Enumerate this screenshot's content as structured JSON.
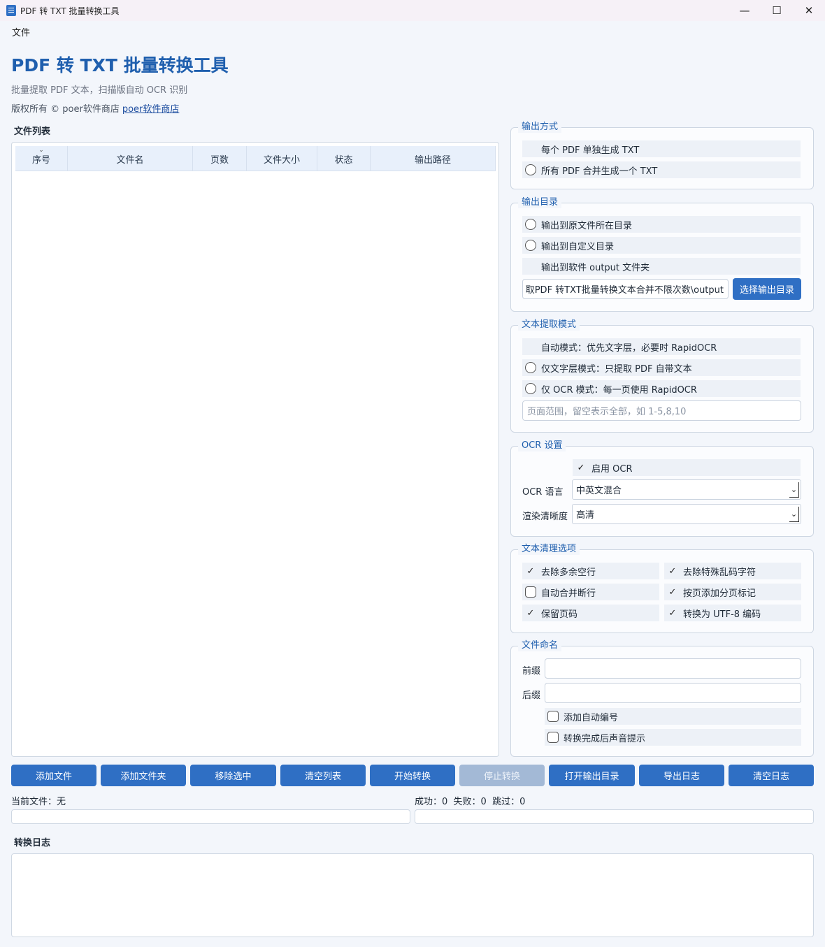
{
  "window": {
    "title": "PDF 转 TXT 批量转换工具",
    "minimize": "—",
    "maximize": "☐",
    "close": "✕"
  },
  "menu": {
    "file": "文件"
  },
  "header": {
    "title": "PDF 转 TXT 批量转换工具",
    "subtitle": "批量提取 PDF 文本，扫描版自动 OCR 识别",
    "copyright": "版权所有 © poer软件商店",
    "link": "poer软件商店"
  },
  "file_list": {
    "label": "文件列表",
    "columns": [
      "序号",
      "文件名",
      "页数",
      "文件大小",
      "状态",
      "输出路径"
    ],
    "rows": []
  },
  "output_mode": {
    "title": "输出方式",
    "options": [
      "每个 PDF 单独生成 TXT",
      "所有 PDF 合并生成一个 TXT"
    ],
    "selected": 0
  },
  "output_dir": {
    "title": "输出目录",
    "options": [
      "输出到原文件所在目录",
      "输出到自定义目录",
      "输出到软件 output 文件夹"
    ],
    "selected": 2,
    "path": "取PDF 转TXT批量转换文本合并不限次数\\output",
    "choose_button": "选择输出目录"
  },
  "extract_mode": {
    "title": "文本提取模式",
    "options": [
      "自动模式：优先文字层，必要时 RapidOCR",
      "仅文字层模式：只提取 PDF 自带文本",
      "仅 OCR 模式：每一页使用 RapidOCR"
    ],
    "selected": 0,
    "page_range_placeholder": "页面范围，留空表示全部，如 1-5,8,10"
  },
  "ocr": {
    "title": "OCR 设置",
    "enable_label": "启用 OCR",
    "enabled": true,
    "language_label": "OCR 语言",
    "language_value": "中英文混合",
    "clarity_label": "渲染清晰度",
    "clarity_value": "高清"
  },
  "cleanup": {
    "title": "文本清理选项",
    "options": [
      {
        "label": "去除多余空行",
        "checked": true
      },
      {
        "label": "去除特殊乱码字符",
        "checked": true
      },
      {
        "label": "自动合并断行",
        "checked": false
      },
      {
        "label": "按页添加分页标记",
        "checked": true
      },
      {
        "label": "保留页码",
        "checked": true
      },
      {
        "label": "转换为 UTF-8 编码",
        "checked": true
      }
    ]
  },
  "naming": {
    "title": "文件命名",
    "prefix_label": "前缀",
    "prefix_value": "",
    "suffix_label": "后缀",
    "suffix_value": "",
    "auto_number": {
      "label": "添加自动编号",
      "checked": false
    },
    "sound": {
      "label": "转换完成后声音提示",
      "checked": false
    }
  },
  "actions": {
    "add_file": "添加文件",
    "add_folder": "添加文件夹",
    "remove_selected": "移除选中",
    "clear_list": "清空列表",
    "start": "开始转换",
    "stop": "停止转换",
    "open_output": "打开输出目录",
    "export_log": "导出日志",
    "clear_log": "清空日志"
  },
  "status": {
    "current_file": "当前文件：无",
    "counts": "成功：0  失败：0  跳过：0",
    "file_progress": 0,
    "total_progress": 0
  },
  "log": {
    "label": "转换日志",
    "content": ""
  },
  "colors": {
    "accent": "#2f6fc4",
    "title": "#1f5fae",
    "disabled": "#a3b9d6"
  }
}
